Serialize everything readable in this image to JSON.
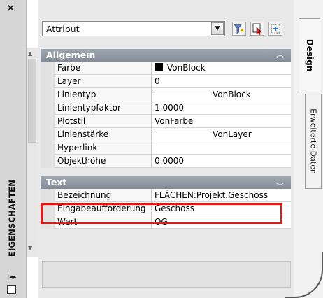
{
  "sidebar": {
    "close_glyph": "×",
    "title": "EIGENSCHAFTEN"
  },
  "selector": {
    "value": "Attribut"
  },
  "toolbar": {
    "icons": [
      "filter-icon",
      "select-objects-icon",
      "quick-select-icon"
    ]
  },
  "categories": {
    "general": {
      "title": "Allgemein",
      "rows": [
        {
          "name": "Farbe",
          "value": "VonBlock"
        },
        {
          "name": "Layer",
          "value": "0"
        },
        {
          "name": "Linientyp",
          "value": "VonBlock"
        },
        {
          "name": "Linientypfaktor",
          "value": "1.0000"
        },
        {
          "name": "Plotstil",
          "value": "VonFarbe"
        },
        {
          "name": "Linienstärke",
          "value": "VonLayer"
        },
        {
          "name": "Hyperlink",
          "value": ""
        },
        {
          "name": "Objekthöhe",
          "value": "0.0000"
        }
      ]
    },
    "text": {
      "title": "Text",
      "rows": [
        {
          "name": "Bezeichnung",
          "value": "FLÄCHEN:Projekt.Geschoss"
        },
        {
          "name": "Eingabeaufforderung",
          "value": "Geschoss"
        },
        {
          "name": "Wert",
          "value": "OG"
        }
      ]
    }
  },
  "tabs": {
    "design": "Design",
    "extended": "Erweiterte Daten"
  },
  "colors": {
    "header_bg": "#939ba5",
    "highlight": "#e01818"
  }
}
